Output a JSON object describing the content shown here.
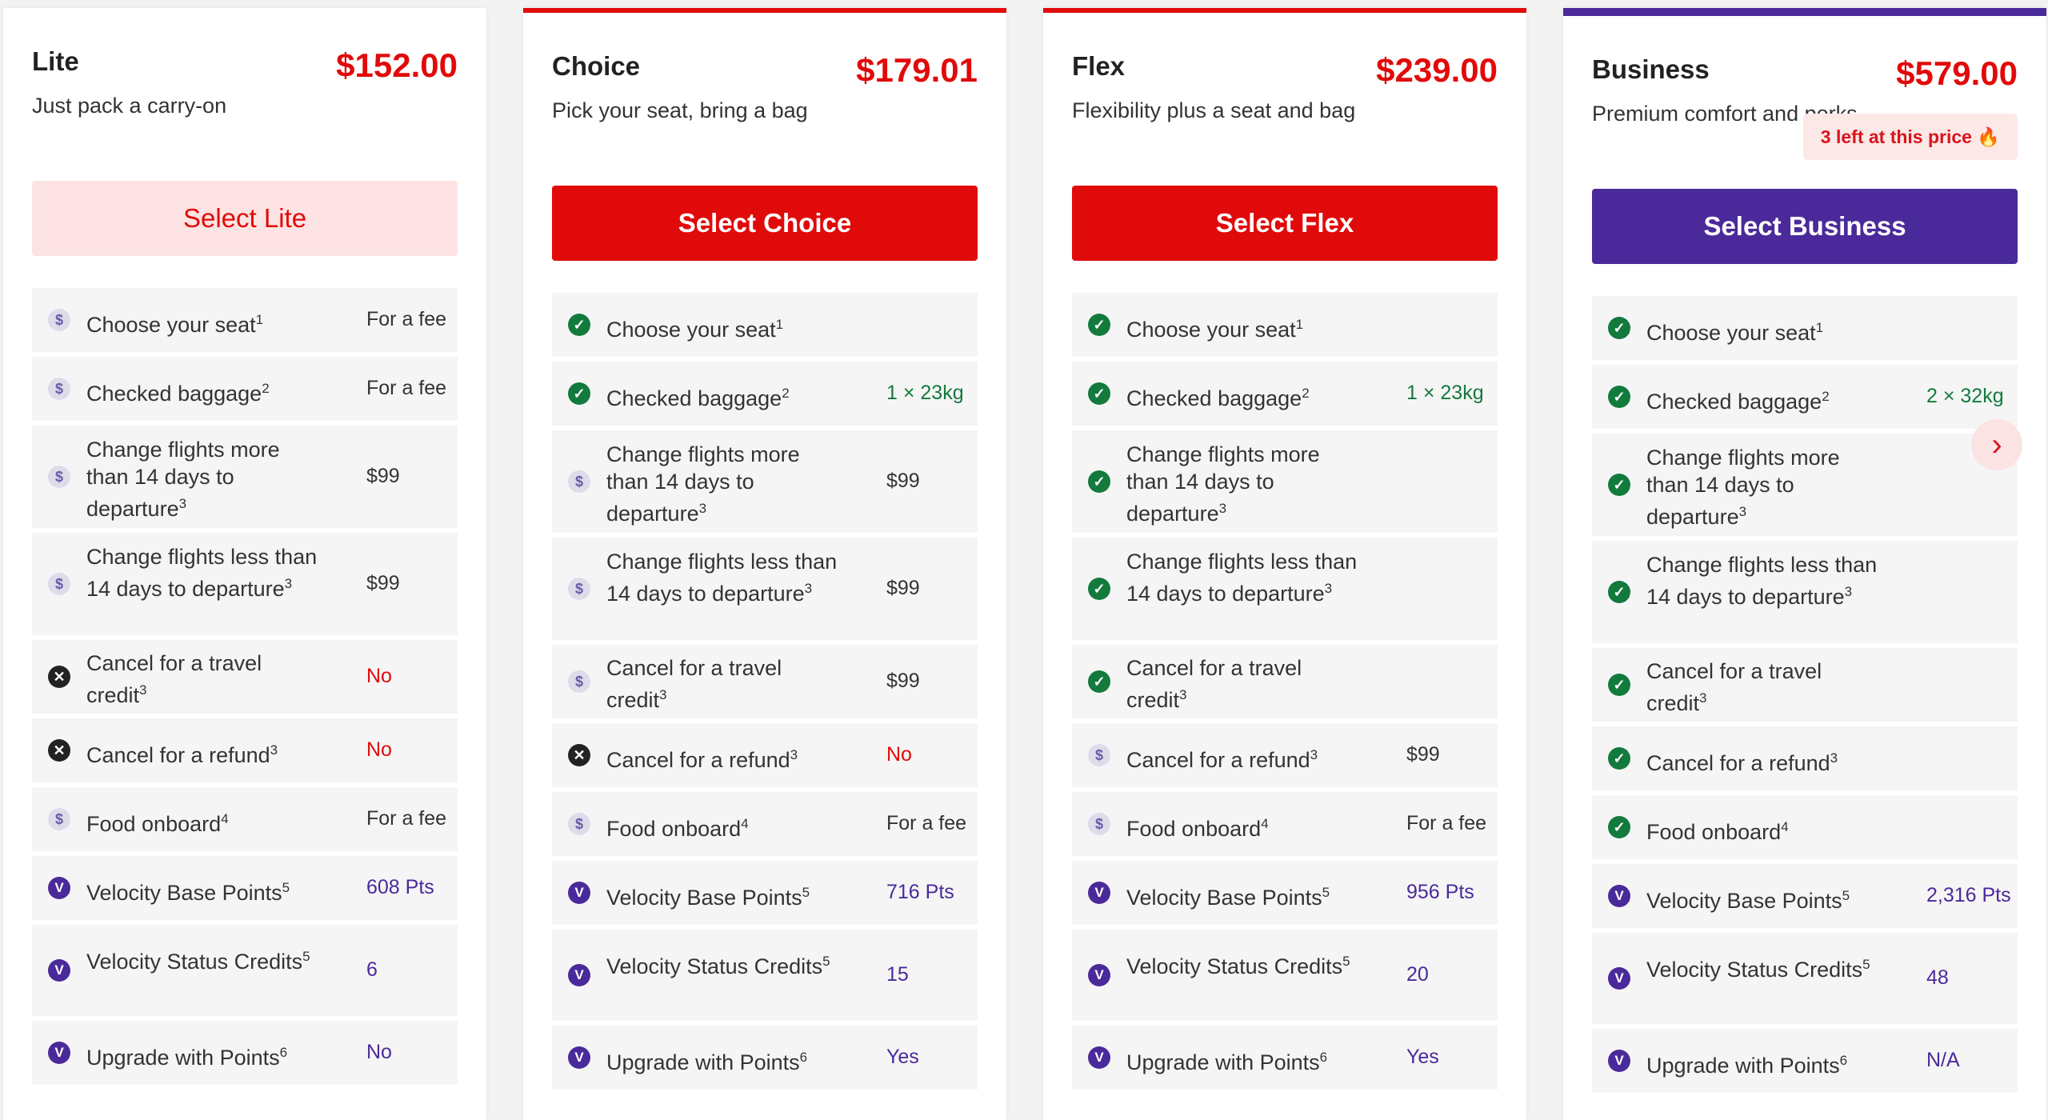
{
  "fares": [
    {
      "name": "Lite",
      "price": "$152.00",
      "desc": "Just pack a carry-on",
      "badge": "",
      "button": "Select Lite",
      "btn_style": "lite",
      "rows": [
        {
          "icon": "fee",
          "label": "Choose your seat",
          "sup": "1",
          "value": "For a fee",
          "vstyle": "grey"
        },
        {
          "icon": "fee",
          "label": "Checked baggage",
          "sup": "2",
          "value": "For a fee",
          "vstyle": "grey"
        },
        {
          "icon": "fee",
          "label": "Change flights more than 14 days to departure",
          "sup": "3",
          "value": "$99",
          "vstyle": "grey"
        },
        {
          "icon": "fee",
          "label": "Change flights less than 14 days to departure",
          "sup": "3",
          "value": "$99",
          "vstyle": "grey"
        },
        {
          "icon": "cross",
          "label": "Cancel for a travel credit",
          "sup": "3",
          "value": "No",
          "vstyle": "red"
        },
        {
          "icon": "cross",
          "label": "Cancel for a refund",
          "sup": "3",
          "value": "No",
          "vstyle": "red"
        },
        {
          "icon": "fee",
          "label": "Food onboard",
          "sup": "4",
          "value": "For a fee",
          "vstyle": "grey"
        },
        {
          "icon": "velo",
          "label": "Velocity Base Points",
          "sup": "5",
          "value": "608 Pts",
          "vstyle": "purple"
        },
        {
          "icon": "velo",
          "label": "Velocity Status Credits",
          "sup": "5",
          "value": "6",
          "vstyle": "purple"
        },
        {
          "icon": "velo",
          "label": "Upgrade with Points",
          "sup": "6",
          "value": "No",
          "vstyle": "purple"
        }
      ]
    },
    {
      "name": "Choice",
      "price": "$179.01",
      "desc": "Pick your seat, bring a bag",
      "badge": "",
      "button": "Select Choice",
      "btn_style": "red",
      "rows": [
        {
          "icon": "check",
          "label": "Choose your seat",
          "sup": "1",
          "value": "",
          "vstyle": "grey"
        },
        {
          "icon": "check",
          "label": "Checked baggage",
          "sup": "2",
          "value": "1 × 23kg",
          "vstyle": "green"
        },
        {
          "icon": "fee",
          "label": "Change flights more than 14 days to departure",
          "sup": "3",
          "value": "$99",
          "vstyle": "grey"
        },
        {
          "icon": "fee",
          "label": "Change flights less than 14 days to departure",
          "sup": "3",
          "value": "$99",
          "vstyle": "grey"
        },
        {
          "icon": "fee",
          "label": "Cancel for a travel credit",
          "sup": "3",
          "value": "$99",
          "vstyle": "grey"
        },
        {
          "icon": "cross",
          "label": "Cancel for a refund",
          "sup": "3",
          "value": "No",
          "vstyle": "red"
        },
        {
          "icon": "fee",
          "label": "Food onboard",
          "sup": "4",
          "value": "For a fee",
          "vstyle": "grey"
        },
        {
          "icon": "velo",
          "label": "Velocity Base Points",
          "sup": "5",
          "value": "716 Pts",
          "vstyle": "purple"
        },
        {
          "icon": "velo",
          "label": "Velocity Status Credits",
          "sup": "5",
          "value": "15",
          "vstyle": "purple"
        },
        {
          "icon": "velo",
          "label": "Upgrade with Points",
          "sup": "6",
          "value": "Yes",
          "vstyle": "purple"
        }
      ]
    },
    {
      "name": "Flex",
      "price": "$239.00",
      "desc": "Flexibility plus a seat and bag",
      "badge": "",
      "button": "Select Flex",
      "btn_style": "red",
      "rows": [
        {
          "icon": "check",
          "label": "Choose your seat",
          "sup": "1",
          "value": "",
          "vstyle": "grey"
        },
        {
          "icon": "check",
          "label": "Checked baggage",
          "sup": "2",
          "value": "1 × 23kg",
          "vstyle": "green"
        },
        {
          "icon": "check",
          "label": "Change flights more than 14 days to departure",
          "sup": "3",
          "value": "",
          "vstyle": "grey"
        },
        {
          "icon": "check",
          "label": "Change flights less than 14 days to departure",
          "sup": "3",
          "value": "",
          "vstyle": "grey"
        },
        {
          "icon": "check",
          "label": "Cancel for a travel credit",
          "sup": "3",
          "value": "",
          "vstyle": "grey"
        },
        {
          "icon": "fee",
          "label": "Cancel for a refund",
          "sup": "3",
          "value": "$99",
          "vstyle": "grey"
        },
        {
          "icon": "fee",
          "label": "Food onboard",
          "sup": "4",
          "value": "For a fee",
          "vstyle": "grey"
        },
        {
          "icon": "velo",
          "label": "Velocity Base Points",
          "sup": "5",
          "value": "956 Pts",
          "vstyle": "purple"
        },
        {
          "icon": "velo",
          "label": "Velocity Status Credits",
          "sup": "5",
          "value": "20",
          "vstyle": "purple"
        },
        {
          "icon": "velo",
          "label": "Upgrade with Points",
          "sup": "6",
          "value": "Yes",
          "vstyle": "purple"
        }
      ]
    },
    {
      "name": "Business",
      "price": "$579.00",
      "desc": "Premium comfort and perks",
      "badge": "3 left at this price",
      "button": "Select Business",
      "btn_style": "purple",
      "rows": [
        {
          "icon": "check",
          "label": "Choose your seat",
          "sup": "1",
          "value": "",
          "vstyle": "grey"
        },
        {
          "icon": "check",
          "label": "Checked baggage",
          "sup": "2",
          "value": "2 × 32kg",
          "vstyle": "green"
        },
        {
          "icon": "check",
          "label": "Change flights more than 14 days to departure",
          "sup": "3",
          "value": "",
          "vstyle": "grey"
        },
        {
          "icon": "check",
          "label": "Change flights less than 14 days to departure",
          "sup": "3",
          "value": "",
          "vstyle": "grey"
        },
        {
          "icon": "check",
          "label": "Cancel for a travel credit",
          "sup": "3",
          "value": "",
          "vstyle": "grey"
        },
        {
          "icon": "check",
          "label": "Cancel for a refund",
          "sup": "3",
          "value": "",
          "vstyle": "grey"
        },
        {
          "icon": "check",
          "label": "Food onboard",
          "sup": "4",
          "value": "",
          "vstyle": "grey"
        },
        {
          "icon": "velo",
          "label": "Velocity Base Points",
          "sup": "5",
          "value": "2,316 Pts",
          "vstyle": "purple"
        },
        {
          "icon": "velo",
          "label": "Velocity Status Credits",
          "sup": "5",
          "value": "48",
          "vstyle": "purple"
        },
        {
          "icon": "velo",
          "label": "Upgrade with Points",
          "sup": "6",
          "value": "N/A",
          "vstyle": "purple"
        }
      ]
    }
  ],
  "icons": {
    "fee": "$",
    "check": "✓",
    "cross": "✕",
    "velo": "V"
  },
  "badge_icon": "flame-icon",
  "next_icon": "chevron-right-icon",
  "colors": {
    "brand_red": "#e10a0a",
    "brand_purple": "#4a2a9a",
    "included_green": "#137a3e"
  }
}
